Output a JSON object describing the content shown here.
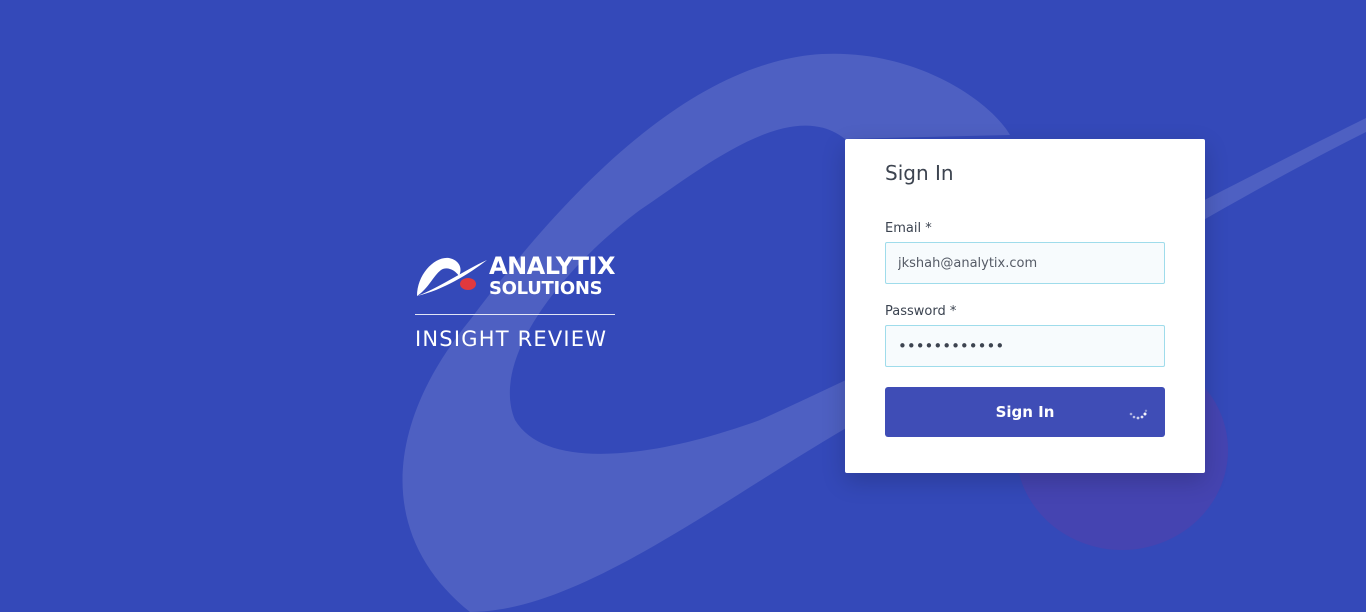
{
  "brand": {
    "logo_line1": "ANALYTIX",
    "logo_line2": "SOLUTIONS",
    "product_name": "INSIGHT REVIEW"
  },
  "signin": {
    "title": "Sign In",
    "email_label": "Email *",
    "email_value": "jkshah@analytix.com",
    "password_label": "Password *",
    "password_value": "••••••••••••",
    "button_label": "Sign In",
    "loading": true
  },
  "colors": {
    "background": "#3449b9",
    "button": "#3f4db6",
    "input_border": "#9fdceb",
    "logo_accent": "#e0393e"
  },
  "icons": [
    "analytix-logo-icon",
    "loading-spinner-icon"
  ]
}
